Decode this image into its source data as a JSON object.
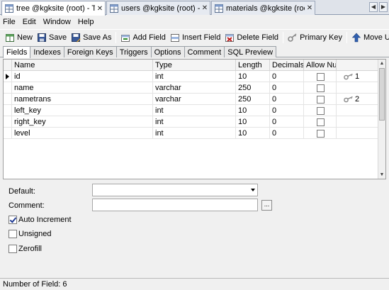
{
  "doc_tabs": [
    {
      "label": "tree @kgksite (root) - Ta...",
      "active": true
    },
    {
      "label": "users @kgksite (root) - T...",
      "active": false
    },
    {
      "label": "materials @kgksite (root)...",
      "active": false
    }
  ],
  "menu": [
    "File",
    "Edit",
    "Window",
    "Help"
  ],
  "toolbar": {
    "new_label": "New",
    "save_label": "Save",
    "save_as_label": "Save As",
    "add_field_label": "Add Field",
    "insert_field_label": "Insert Field",
    "delete_field_label": "Delete Field",
    "primary_key_label": "Primary Key",
    "move_up_label": "Move Up"
  },
  "design_tabs": [
    "Fields",
    "Indexes",
    "Foreign Keys",
    "Triggers",
    "Options",
    "Comment",
    "SQL Preview"
  ],
  "grid": {
    "headers": {
      "name": "Name",
      "type": "Type",
      "length": "Length",
      "decimals": "Decimals",
      "allow_null": "Allow Null"
    },
    "rows": [
      {
        "name": "id",
        "type": "int",
        "length": "10",
        "decimals": "0",
        "allow_null": false,
        "key": "1",
        "selected": true
      },
      {
        "name": "name",
        "type": "varchar",
        "length": "250",
        "decimals": "0",
        "allow_null": false,
        "key": "",
        "selected": false
      },
      {
        "name": "nametrans",
        "type": "varchar",
        "length": "250",
        "decimals": "0",
        "allow_null": false,
        "key": "2",
        "selected": false
      },
      {
        "name": "left_key",
        "type": "int",
        "length": "10",
        "decimals": "0",
        "allow_null": false,
        "key": "",
        "selected": false
      },
      {
        "name": "right_key",
        "type": "int",
        "length": "10",
        "decimals": "0",
        "allow_null": false,
        "key": "",
        "selected": false
      },
      {
        "name": "level",
        "type": "int",
        "length": "10",
        "decimals": "0",
        "allow_null": false,
        "key": "",
        "selected": false
      }
    ]
  },
  "properties": {
    "default_label": "Default:",
    "default_value": "",
    "comment_label": "Comment:",
    "comment_value": "",
    "ellipsis": "...",
    "auto_increment_label": "Auto Increment",
    "auto_increment_checked": true,
    "unsigned_label": "Unsigned",
    "unsigned_checked": false,
    "zerofill_label": "Zerofill",
    "zerofill_checked": false
  },
  "status": {
    "text": "Number of Field: 6"
  },
  "colors": {
    "accent": "#1f3a93",
    "key_gold": "#c9a227"
  }
}
